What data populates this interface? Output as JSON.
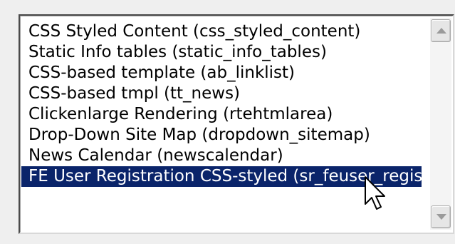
{
  "listbox": {
    "items": [
      {
        "label": "CSS Styled Content (css_styled_content)"
      },
      {
        "label": "Static Info tables (static_info_tables)"
      },
      {
        "label": "CSS-based template (ab_linklist)"
      },
      {
        "label": "CSS-based tmpl (tt_news)"
      },
      {
        "label": "Clickenlarge Rendering (rtehtmlarea)"
      },
      {
        "label": "Drop-Down Site Map (dropdown_sitemap)"
      },
      {
        "label": "News Calendar (newscalendar)"
      },
      {
        "label": "FE User Registration CSS-styled (sr_feuser_register)"
      }
    ],
    "selected_index": 7
  },
  "scrollbar": {
    "up_icon": "arrow-up-icon",
    "down_icon": "arrow-down-icon"
  },
  "cursor": {
    "icon": "mouse-pointer-icon"
  },
  "colors": {
    "selection_bg": "#0a246a",
    "selection_text": "#ffffff",
    "background": "#efefef"
  }
}
